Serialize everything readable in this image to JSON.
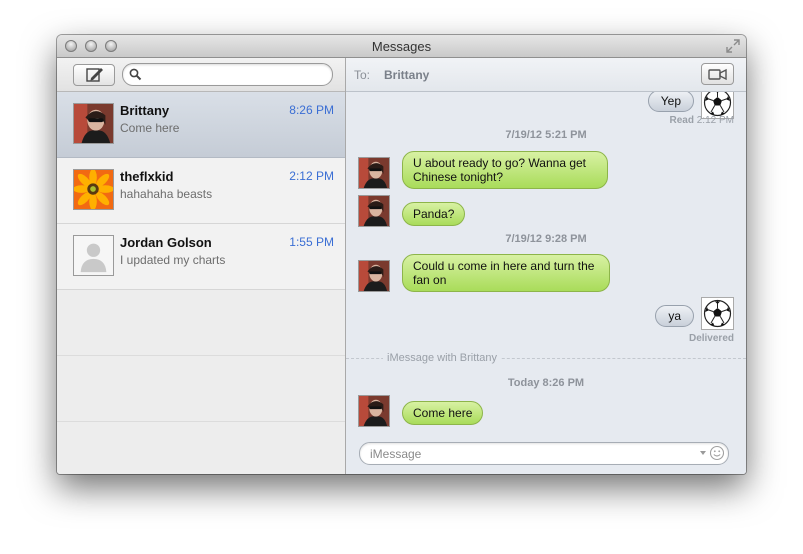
{
  "window": {
    "title": "Messages"
  },
  "sidebar": {
    "search_placeholder": "",
    "conversations": [
      {
        "name": "Brittany",
        "time": "8:26 PM",
        "preview": "Come here",
        "selected": true
      },
      {
        "name": "theflxkid",
        "time": "2:12 PM",
        "preview": "hahahaha beasts",
        "selected": false
      },
      {
        "name": "Jordan Golson",
        "time": "1:55 PM",
        "preview": "I updated my charts",
        "selected": false
      }
    ]
  },
  "header": {
    "to_label": "To:",
    "recipient": "Brittany"
  },
  "transcript": {
    "top_sent": {
      "text": "Yep",
      "status_label": "Read",
      "status_time": "2:12 PM"
    },
    "stamp1": "7/19/12 5:21 PM",
    "msg1_line1": "U about ready to go?  Wanna get",
    "msg1_line2": "Chinese tonight?",
    "msg2": "Panda?",
    "stamp2": "7/19/12 9:28 PM",
    "msg3_line1": "Could u come in here and turn the",
    "msg3_line2": "fan on",
    "sent2": {
      "text": "ya",
      "status_label": "Delivered"
    },
    "divider_label": "iMessage with Brittany",
    "stamp3": "Today 8:26 PM",
    "msg4": "Come here"
  },
  "composer": {
    "placeholder": "iMessage"
  },
  "colors": {
    "accent_time": "#3a6ed4",
    "incoming_bubble": "#a9dc5a",
    "outgoing_bubble": "#c9d0da"
  }
}
